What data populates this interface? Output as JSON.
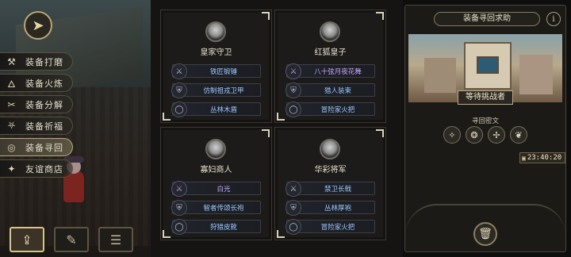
{
  "sidebar": {
    "items": [
      {
        "label": "装备打磨",
        "icon": "hammer-icon",
        "glyph": "⚒",
        "active": false
      },
      {
        "label": "装备火炼",
        "icon": "flame-icon",
        "glyph": "🜂",
        "active": false
      },
      {
        "label": "装备分解",
        "icon": "split-icon",
        "glyph": "✂",
        "active": false
      },
      {
        "label": "装备祈福",
        "icon": "pray-icon",
        "glyph": "⛧",
        "active": false
      },
      {
        "label": "装备寻回",
        "icon": "swirl-icon",
        "glyph": "◎",
        "active": true
      },
      {
        "label": "友谊商店",
        "icon": "fox-icon",
        "glyph": "✦",
        "active": false
      }
    ]
  },
  "bottom_tabs": [
    {
      "icon": "upload-icon",
      "glyph": "⇪",
      "active": true
    },
    {
      "icon": "feather-icon",
      "glyph": "✎",
      "active": false
    },
    {
      "icon": "list-icon",
      "glyph": "☰",
      "active": false
    }
  ],
  "cards": [
    {
      "title": "皇家守卫",
      "slots": [
        {
          "label": "铁匠锻锤",
          "icon": "sword-icon",
          "color": "blue"
        },
        {
          "label": "仿制祖戎卫甲",
          "icon": "armor-icon",
          "color": "blue"
        },
        {
          "label": "丛林木盾",
          "icon": "ring-icon",
          "color": "blue"
        }
      ]
    },
    {
      "title": "红狐皇子",
      "slots": [
        {
          "label": "八十弦月夜花舞",
          "icon": "sword-icon",
          "color": "purple"
        },
        {
          "label": "猎人装束",
          "icon": "armor-icon",
          "color": "blue"
        },
        {
          "label": "冒险家火把",
          "icon": "ring-icon",
          "color": "blue"
        }
      ]
    },
    {
      "title": "寡妇商人",
      "slots": [
        {
          "label": "白光",
          "icon": "sword-icon",
          "color": "purple"
        },
        {
          "label": "智者传颂长袍",
          "icon": "armor-icon",
          "color": "blue"
        },
        {
          "label": "狩猎皮靴",
          "icon": "ring-icon",
          "color": "blue"
        }
      ]
    },
    {
      "title": "华彩将军",
      "slots": [
        {
          "label": "禁卫长戟",
          "icon": "sword-icon",
          "color": "blue"
        },
        {
          "label": "丛林厚袍",
          "icon": "armor-icon",
          "color": "blue"
        },
        {
          "label": "冒险家火把",
          "icon": "ring-icon",
          "color": "blue"
        }
      ]
    }
  ],
  "right_panel": {
    "title": "装备寻回求助",
    "info_glyph": "i",
    "challenger": "等待挑战者",
    "rune_label": "寻回密文",
    "runes": [
      "✧",
      "❂",
      "✢",
      "❦"
    ],
    "timer": "23:40:20",
    "trash_glyph": "🗑"
  }
}
